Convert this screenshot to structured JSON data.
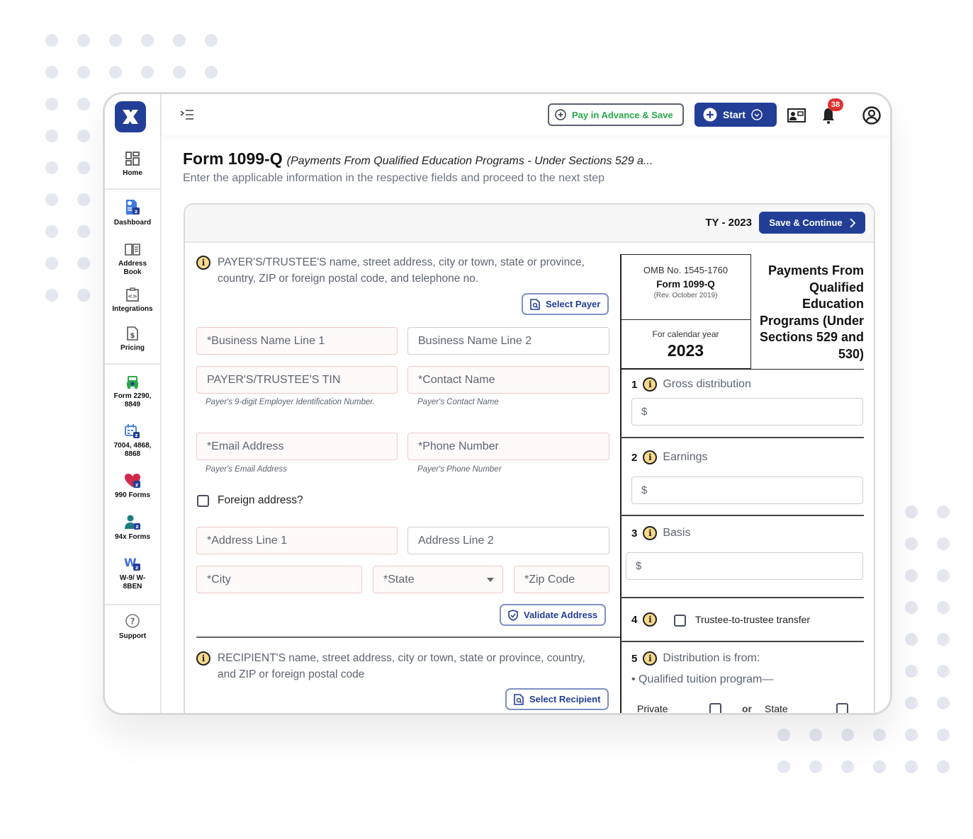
{
  "app": {
    "logo_alt": "TaxZerone logo"
  },
  "sidebar": {
    "items": [
      {
        "label": "Home",
        "icon": "home-grid-icon"
      },
      {
        "label": "Dashboard",
        "icon": "dashboard-icon"
      },
      {
        "label": "Address Book",
        "icon": "address-book-icon"
      },
      {
        "label": "Integrations",
        "icon": "integrations-icon"
      },
      {
        "label": "Pricing",
        "icon": "pricing-icon"
      },
      {
        "label": "Form 2290, 8849",
        "icon": "truck-icon"
      },
      {
        "label": "7004, 4868, 8868",
        "icon": "calendar-icon"
      },
      {
        "label": "990 Forms",
        "icon": "heart-icon"
      },
      {
        "label": "94x Forms",
        "icon": "employee-icon"
      },
      {
        "label": "W-9/ W-8BEN",
        "icon": "w-form-icon"
      },
      {
        "label": "Support",
        "icon": "support-icon"
      }
    ]
  },
  "topbar": {
    "pay_advance_label": "Pay in Advance & Save",
    "start_label": "Start",
    "notification_count": "38"
  },
  "page": {
    "title": "Form 1099-Q",
    "subtitle": "(Payments From Qualified Education Programs - Under Sections 529 a...",
    "description": "Enter the applicable information in the respective fields and proceed to the next step"
  },
  "form": {
    "tax_year": "TY - 2023",
    "save_continue_label": "Save & Continue",
    "payer": {
      "section_label": "PAYER'S/TRUSTEE'S name, street address, city or town, state or province, country, ZIP or foreign postal code, and telephone no.",
      "select_button": "Select Payer",
      "fields": {
        "business_name_1": "*Business Name Line 1",
        "business_name_2": "Business Name Line 2",
        "tin": "PAYER'S/TRUSTEE'S TIN",
        "tin_hint": "Payer's 9-digit Employer Identification Number.",
        "contact_name": "*Contact Name",
        "contact_hint": "Payer's Contact Name",
        "email": "*Email Address",
        "email_hint": "Payer's Email Address",
        "phone": "*Phone Number",
        "phone_hint": "Payer's Phone Number",
        "foreign_address": "Foreign address?",
        "address_1": "*Address Line 1",
        "address_2": "Address Line 2",
        "city": "*City",
        "state": "*State",
        "zip": "*Zip Code"
      },
      "validate_button": "Validate Address"
    },
    "recipient": {
      "section_label": "RECIPIENT'S name, street address, city or town, state or province, country, and ZIP or foreign postal code",
      "select_button": "Select Recipient"
    },
    "header_box": {
      "omb": "OMB No. 1545-1760",
      "form_name": "Form 1099-Q",
      "revision": "(Rev. October 2019)",
      "calendar_label": "For calendar year",
      "year": "2023",
      "title": "Payments From Qualified Education Programs (Under Sections 529 and 530)"
    },
    "boxes": [
      {
        "num": "1",
        "label": "Gross distribution",
        "value": "$"
      },
      {
        "num": "2",
        "label": "Earnings",
        "value": "$"
      },
      {
        "num": "3",
        "label": "Basis",
        "value": "$"
      },
      {
        "num": "4",
        "label": "Trustee-to-trustee transfer"
      },
      {
        "num": "5",
        "label": "Distribution is from:",
        "sub": "• Qualified tuition program—",
        "opt_private": "Private",
        "opt_or": "or",
        "opt_state": "State"
      }
    ]
  }
}
